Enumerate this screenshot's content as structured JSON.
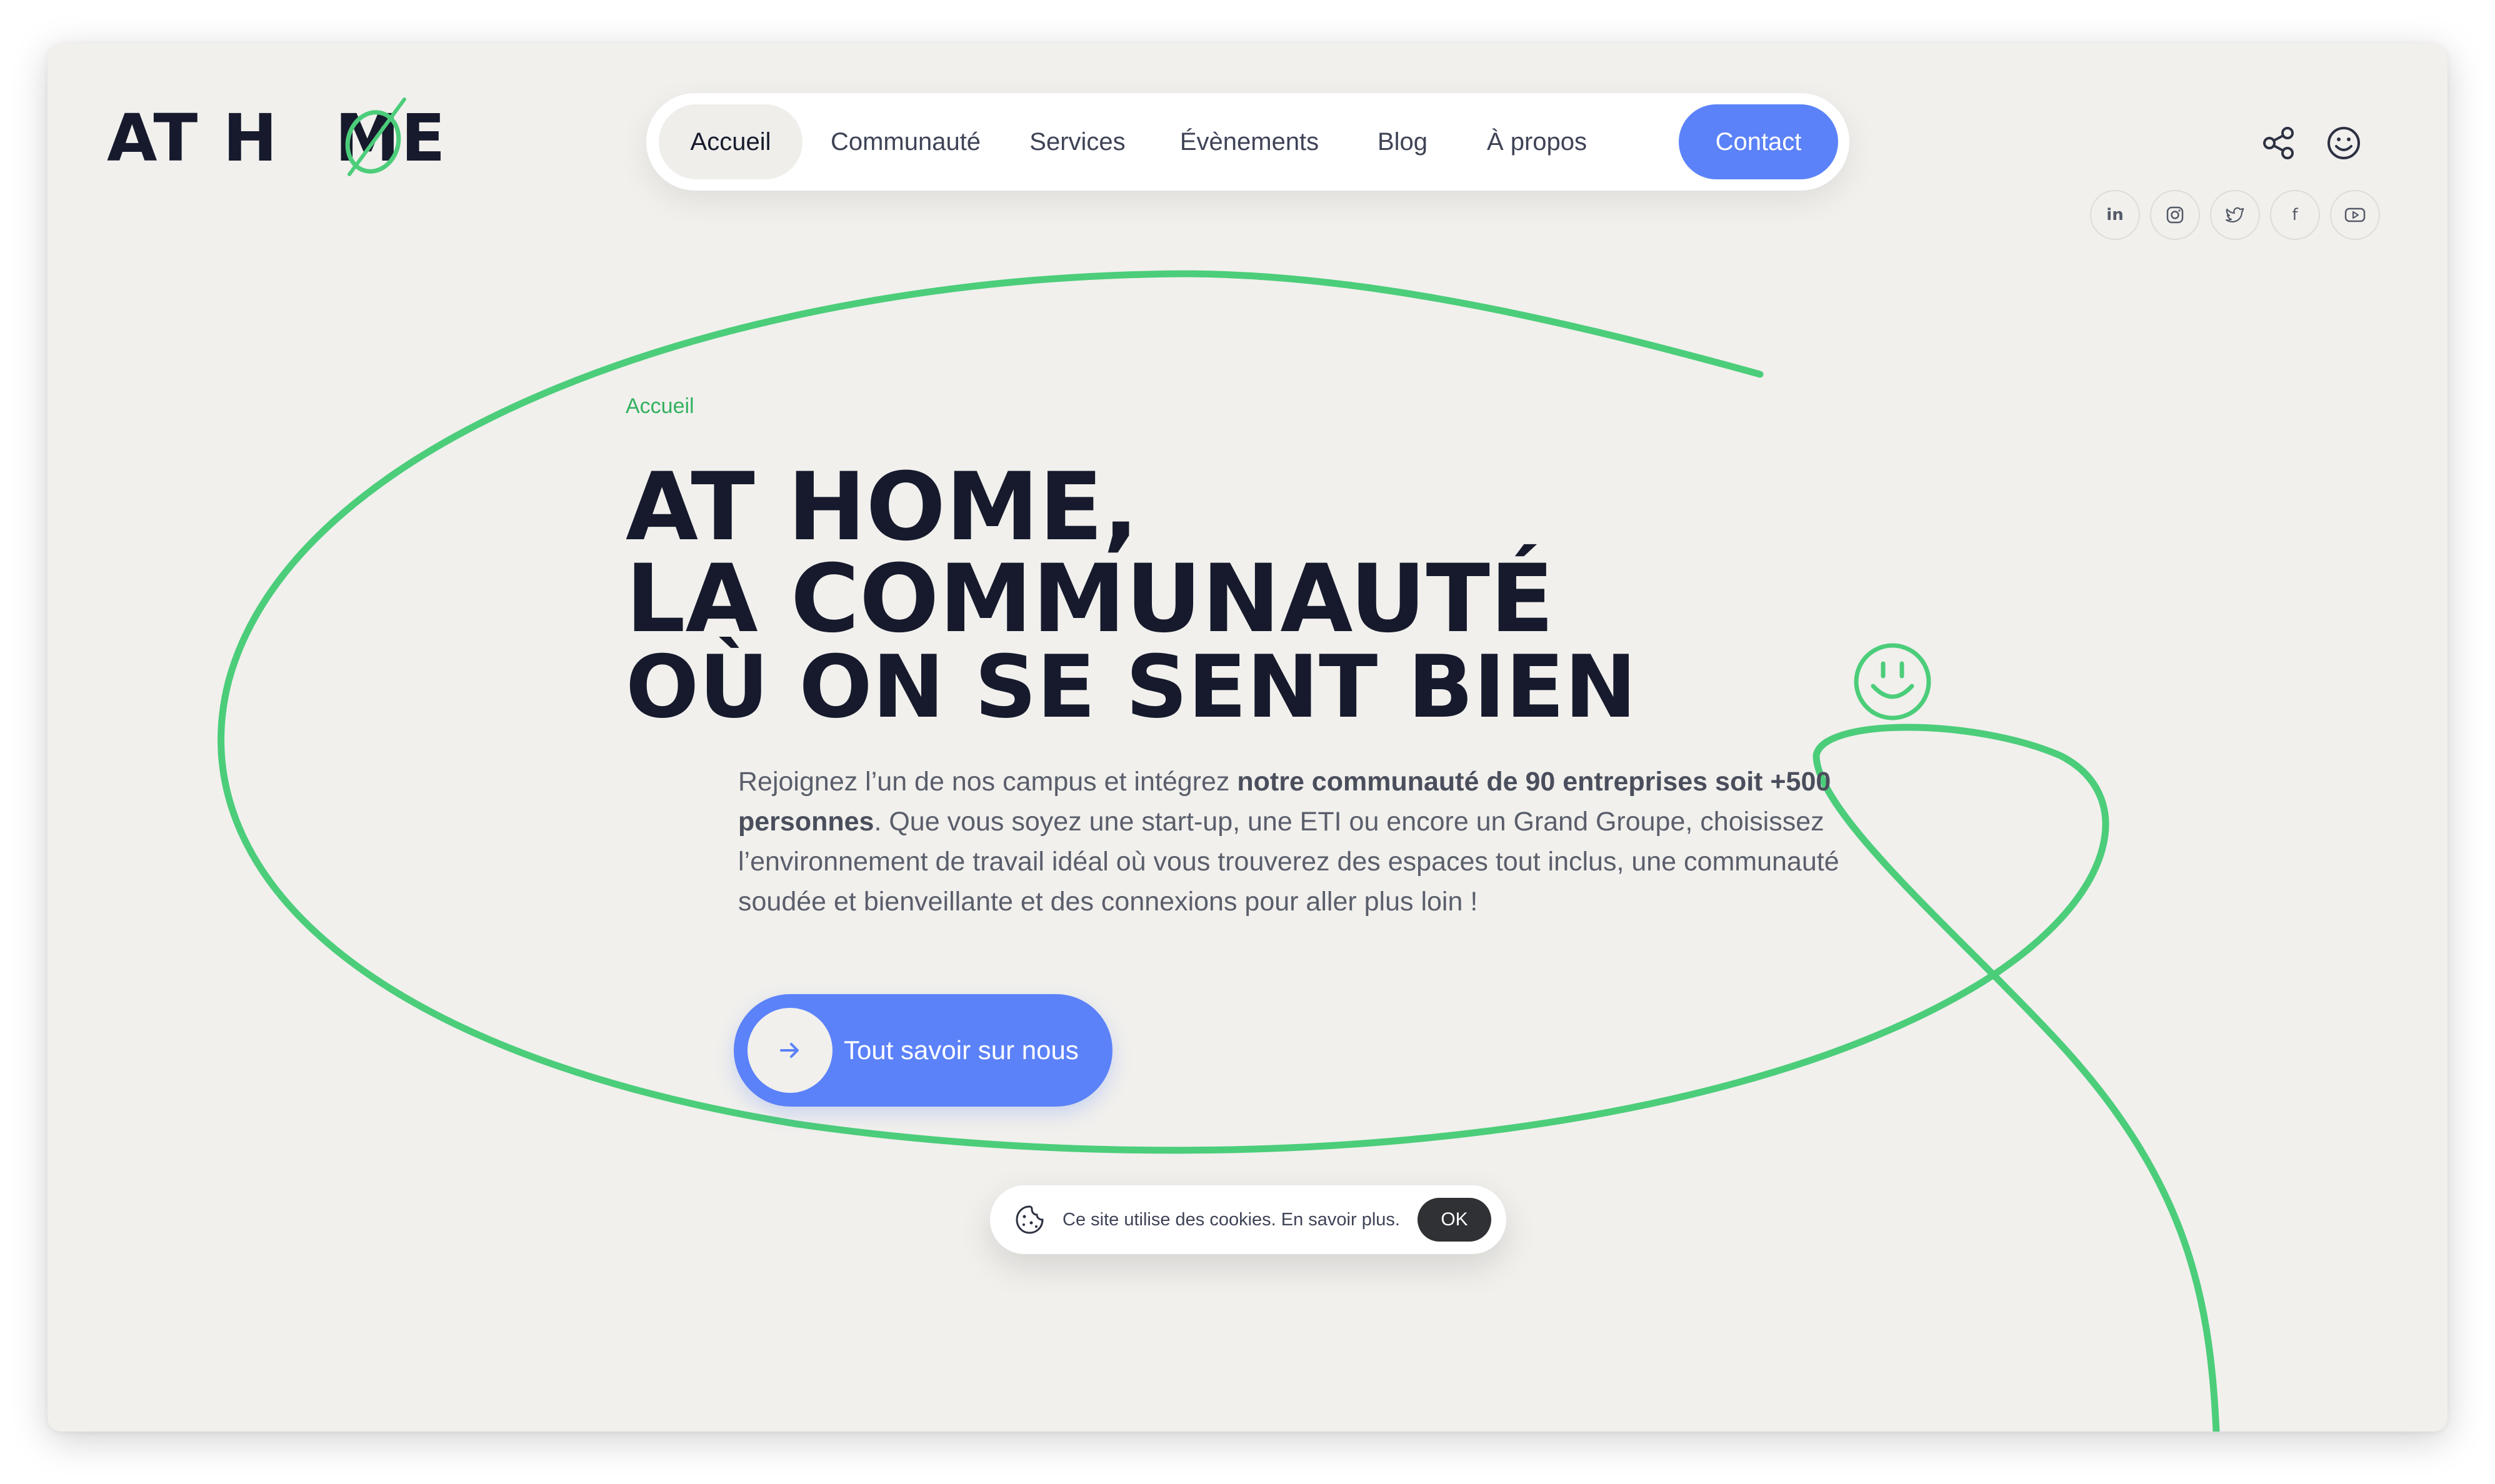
{
  "brand": {
    "logo_text_left": "AT H",
    "logo_text_o": "O",
    "logo_text_right": "ME",
    "accent_green": "#4ccd7a",
    "accent_blue": "#5b82f8",
    "dark": "#161a2c"
  },
  "nav": {
    "items": [
      {
        "label": "Accueil",
        "active": true
      },
      {
        "label": "Communauté"
      },
      {
        "label": "Services"
      },
      {
        "label": "Évènements"
      },
      {
        "label": "Blog"
      },
      {
        "label": "À propos"
      }
    ],
    "contact_label": "Contact"
  },
  "header_icons": [
    "share-icon",
    "smiley-icon"
  ],
  "social": [
    {
      "icon": "linkedin-icon",
      "glyph": "in"
    },
    {
      "icon": "instagram-icon",
      "glyph": ""
    },
    {
      "icon": "twitter-icon",
      "glyph": ""
    },
    {
      "icon": "facebook-icon",
      "glyph": "f"
    },
    {
      "icon": "youtube-icon",
      "glyph": ""
    }
  ],
  "hero": {
    "breadcrumb": "Accueil",
    "title_line1": "AT HOME,",
    "title_line2": "LA COMMUNAUTÉ",
    "title_line3": "OÙ ON SE SENT BIEN",
    "desc_part1": "Rejoignez l’un de nos campus et intégrez ",
    "desc_bold": "notre communauté de 90 entreprises soit +500 personnes",
    "desc_part2": ". Que vous soyez une start-up, une ETI ou encore un Grand Groupe, choisissez l’environnement de travail idéal où vous trouverez des espaces tout inclus, une communauté soudée et bienveillante et des connexions pour aller plus loin !",
    "cta_label": "Tout savoir sur nous"
  },
  "cookie": {
    "text": "Ce site utilise des cookies. En savoir plus.",
    "ok_label": "OK"
  }
}
